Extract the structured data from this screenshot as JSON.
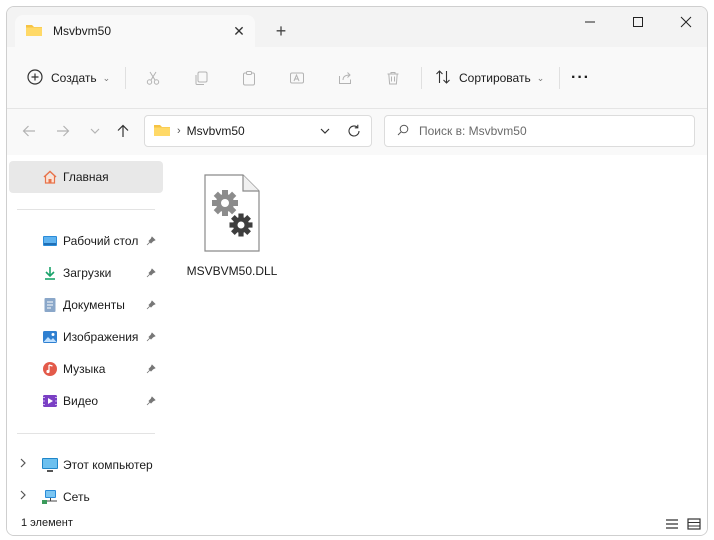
{
  "tab": {
    "title": "Msvbvm50",
    "close_glyph": "✕",
    "new_tab_glyph": "+"
  },
  "window_controls": {
    "minimize": "—",
    "maximize": "☐",
    "close": "✕"
  },
  "toolbar": {
    "create_label": "Создать",
    "sort_label": "Сортировать",
    "more_glyph": "···",
    "icons": [
      "plus-circle-icon",
      "cut-icon",
      "copy-icon",
      "paste-icon",
      "rename-icon",
      "share-icon",
      "delete-icon",
      "sort-icon"
    ]
  },
  "address": {
    "crumb": "Msvbvm50",
    "separator": "›",
    "search_placeholder": "Поиск в: Msvbvm50"
  },
  "sidebar": {
    "home": "Главная",
    "quick_access": [
      {
        "label": "Рабочий стол",
        "icon": "desktop-icon"
      },
      {
        "label": "Загрузки",
        "icon": "downloads-icon"
      },
      {
        "label": "Документы",
        "icon": "documents-icon"
      },
      {
        "label": "Изображения",
        "icon": "pictures-icon"
      },
      {
        "label": "Музыка",
        "icon": "music-icon"
      },
      {
        "label": "Видео",
        "icon": "videos-icon"
      }
    ],
    "this_pc": "Этот компьютер",
    "network": "Сеть"
  },
  "content": {
    "files": [
      {
        "name": "MSVBVM50.DLL",
        "icon": "dll-file-icon"
      }
    ]
  },
  "status": {
    "item_count": "1 элемент"
  },
  "colors": {
    "folder": "#f6c343",
    "accent": "#0067c0",
    "selected_bg": "#e8e8e8"
  }
}
